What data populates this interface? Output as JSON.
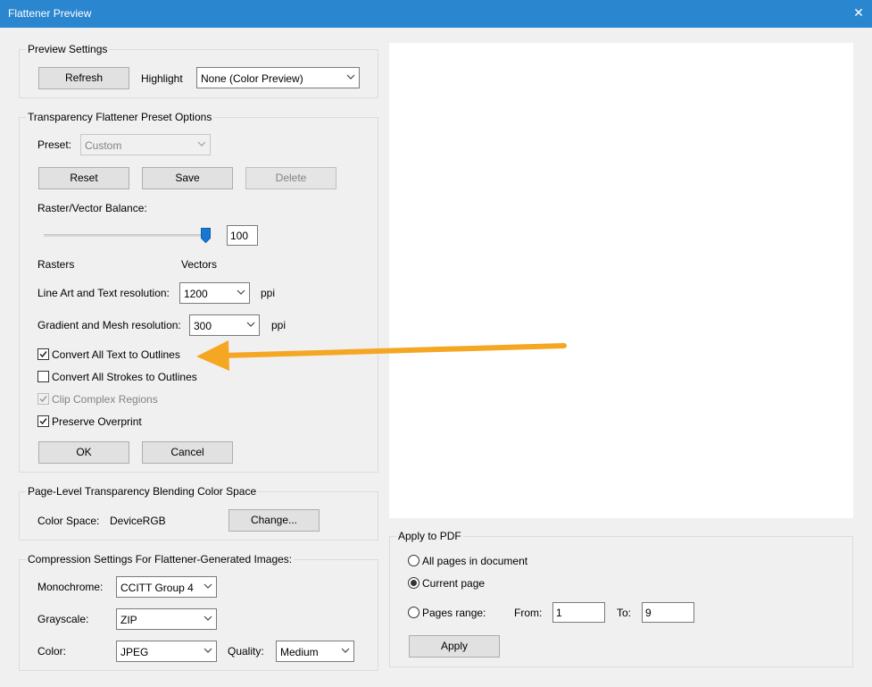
{
  "window": {
    "title": "Flattener Preview",
    "close_glyph": "✕"
  },
  "preview_settings": {
    "legend": "Preview Settings",
    "refresh_label": "Refresh",
    "highlight_label": "Highlight",
    "highlight_value": "None (Color Preview)"
  },
  "preset_options": {
    "legend": "Transparency Flattener Preset Options",
    "preset_label": "Preset:",
    "preset_value": "Custom",
    "reset_label": "Reset",
    "save_label": "Save",
    "delete_label": "Delete",
    "balance_label": "Raster/Vector Balance:",
    "balance_value": "100",
    "rasters_label": "Rasters",
    "vectors_label": "Vectors",
    "line_art_label": "Line Art and Text resolution:",
    "line_art_value": "1200",
    "line_art_unit": "ppi",
    "gradient_label": "Gradient and Mesh resolution:",
    "gradient_value": "300",
    "gradient_unit": "ppi",
    "convert_text_label": "Convert All Text to Outlines",
    "convert_text_checked": true,
    "convert_strokes_label": "Convert All Strokes to Outlines",
    "convert_strokes_checked": false,
    "clip_regions_label": "Clip Complex Regions",
    "clip_regions_checked": true,
    "preserve_overprint_label": "Preserve Overprint",
    "preserve_overprint_checked": true,
    "ok_label": "OK",
    "cancel_label": "Cancel"
  },
  "blending": {
    "legend": "Page-Level Transparency Blending Color Space",
    "color_space_label": "Color Space:",
    "color_space_value": "DeviceRGB",
    "change_label": "Change..."
  },
  "compression": {
    "legend": "Compression Settings For Flattener-Generated Images:",
    "monochrome_label": "Monochrome:",
    "monochrome_value": "CCITT Group 4",
    "grayscale_label": "Grayscale:",
    "grayscale_value": "ZIP",
    "color_label": "Color:",
    "color_value": "JPEG",
    "quality_label": "Quality:",
    "quality_value": "Medium"
  },
  "apply_to_pdf": {
    "legend": "Apply to PDF",
    "all_pages_label": "All pages in document",
    "current_page_label": "Current page",
    "pages_range_label": "Pages range:",
    "selected": "current_page",
    "from_label": "From:",
    "from_value": "1",
    "to_label": "To:",
    "to_value": "9",
    "apply_label": "Apply"
  },
  "annotation": {
    "arrow_color": "#f5a623",
    "arrow_icon": "arrow-left-icon"
  },
  "colors": {
    "titlebar": "#2b86d0",
    "slider_thumb": "#1976d2"
  }
}
